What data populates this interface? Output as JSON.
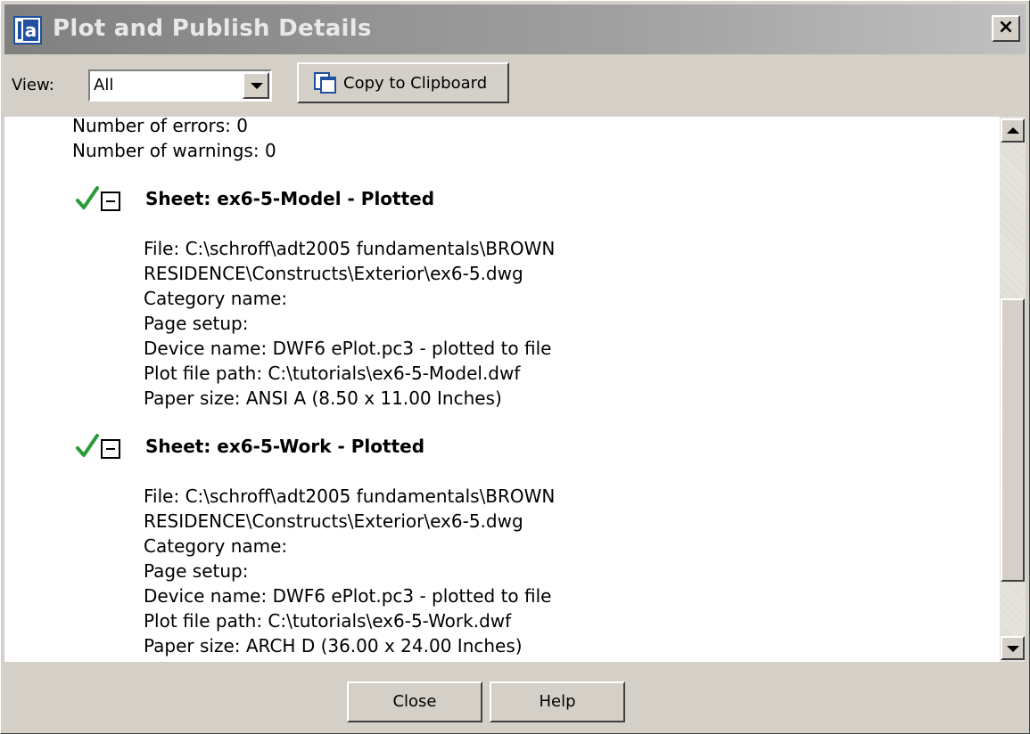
{
  "window": {
    "title": "Plot and Publish Details",
    "close_glyph": "✕",
    "app_icon": "app-icon"
  },
  "toolbar": {
    "view_label": "View:",
    "view_value": "All",
    "copy_label": "Copy to Clipboard"
  },
  "summary": {
    "errors": "Number of errors: 0",
    "warnings": "Number of warnings: 0"
  },
  "sheets": [
    {
      "title": "Sheet: ex6-5-Model - Plotted",
      "lines": [
        "File: C:\\schroff\\adt2005 fundamentals\\BROWN",
        "RESIDENCE\\Constructs\\Exterior\\ex6-5.dwg",
        "Category name:",
        "Page setup:",
        "Device name: DWF6 ePlot.pc3 - plotted to file",
        "Plot file path: C:\\tutorials\\ex6-5-Model.dwf",
        "Paper size: ANSI A (8.50 x 11.00 Inches)"
      ]
    },
    {
      "title": "Sheet: ex6-5-Work - Plotted",
      "lines": [
        "File: C:\\schroff\\adt2005 fundamentals\\BROWN",
        "RESIDENCE\\Constructs\\Exterior\\ex6-5.dwg",
        "Category name:",
        "Page setup:",
        "Device name: DWF6 ePlot.pc3 - plotted to file",
        "Plot file path: C:\\tutorials\\ex6-5-Work.dwf",
        "Paper size: ARCH D (36.00 x 24.00 Inches)"
      ]
    }
  ],
  "footer": {
    "close_label": "Close",
    "help_label": "Help"
  },
  "colors": {
    "check": "#2a9a3a",
    "dialog_bg": "#d4d0c8"
  }
}
